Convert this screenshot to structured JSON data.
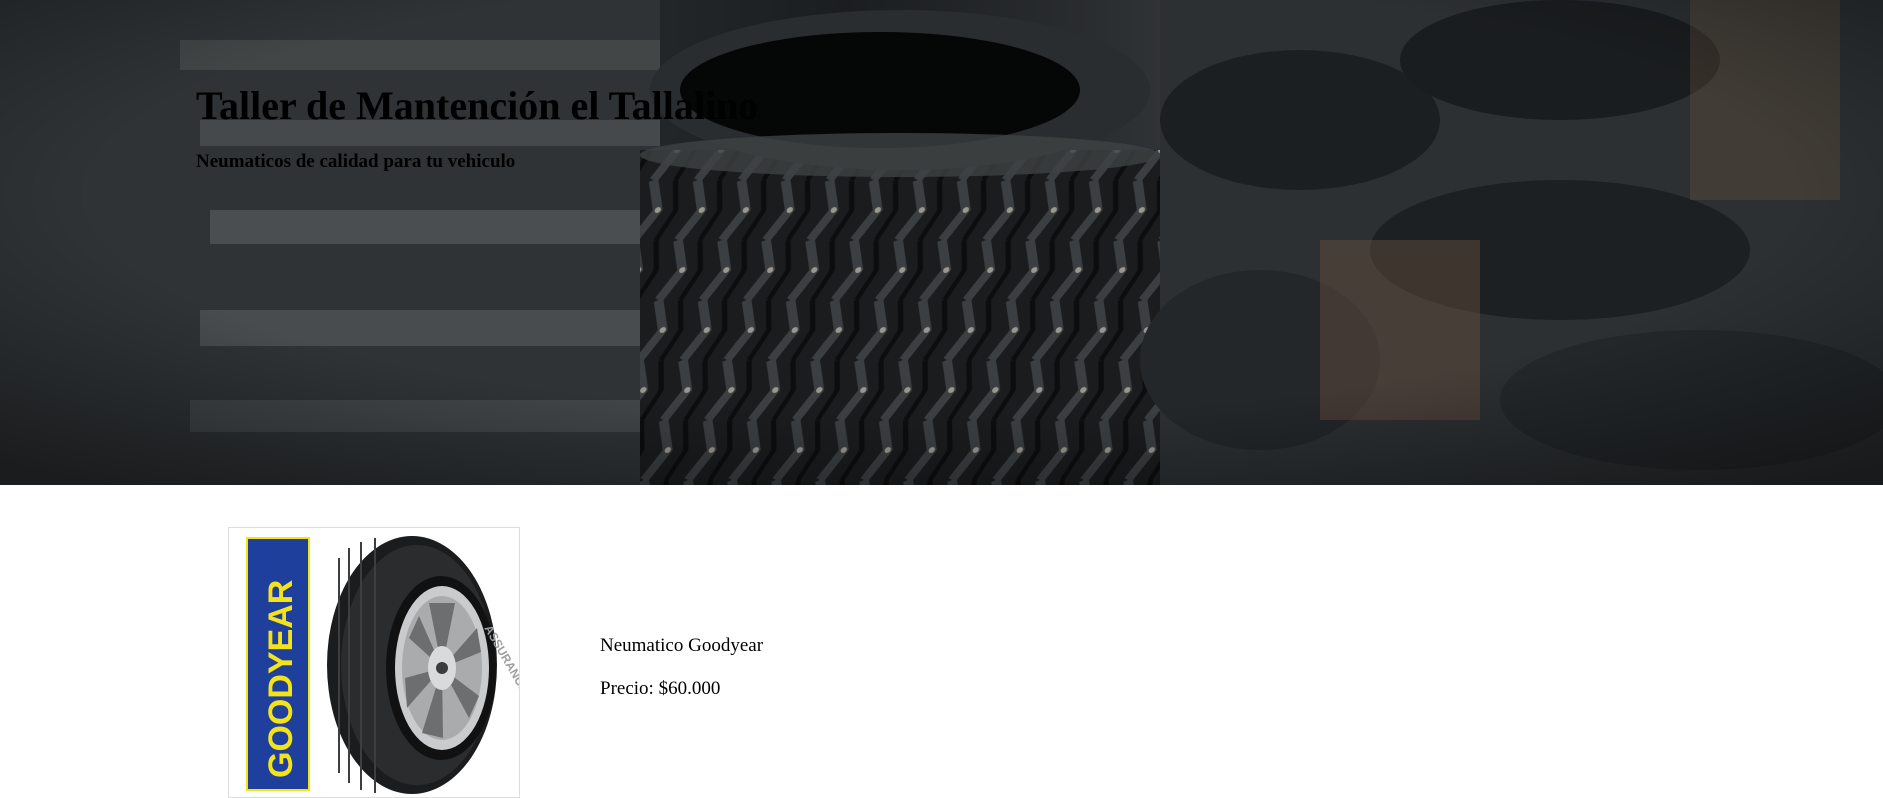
{
  "hero": {
    "title": "Taller de Mantención el Tallalino",
    "subtitle": "Neumaticos de calidad para tu vehiculo"
  },
  "product": {
    "name": "Neumatico Goodyear",
    "price": "Precio: $60.000",
    "brand_text": "GOODYEAR",
    "tire_text": "ASSURANCE"
  },
  "colors": {
    "brand_blue": "#1f3f9c",
    "brand_yellow": "#f5e31a"
  }
}
